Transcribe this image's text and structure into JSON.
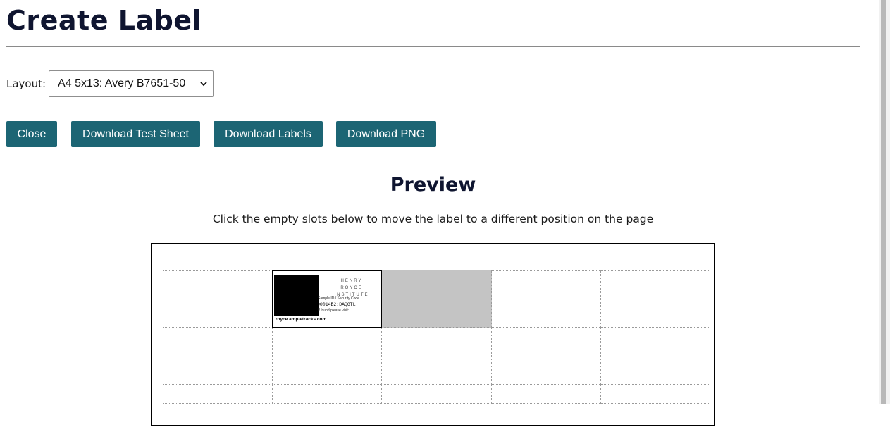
{
  "page": {
    "title": "Create Label"
  },
  "layout": {
    "label": "Layout:",
    "selected": "A4 5x13: Avery B7651-50"
  },
  "actions": {
    "close": "Close",
    "download_test_sheet": "Download Test Sheet",
    "download_labels": "Download Labels",
    "download_png": "Download PNG"
  },
  "preview": {
    "heading": "Preview",
    "hint": "Click the empty slots below to move the label to a different position on the page"
  },
  "label": {
    "brand_line1": "HENRY",
    "brand_line2": "ROYCE",
    "brand_line3": "INSTITUTE",
    "sample_text": "Sample ID / Security Code",
    "code": "00014B2:DAQGTL",
    "found_text": "If found please visit:",
    "url": "royce.ampletracks.com"
  },
  "colors": {
    "accent": "#1c6574",
    "heading": "#0f1530",
    "selected_slot": "#c4c4c4"
  },
  "icons": {
    "select_chevron": "chevron-down-icon",
    "qr_code": "qr-code-icon"
  }
}
